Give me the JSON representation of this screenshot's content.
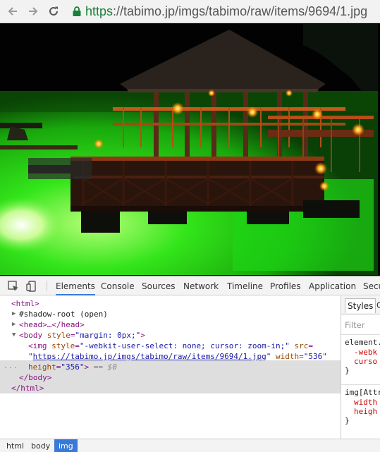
{
  "browser": {
    "url_scheme": "https",
    "url_rest": "://tabimo.jp/imgs/tabimo/raw/items/9694/1.jpg",
    "icons": {
      "back": "arrow-left-icon",
      "forward": "arrow-right-icon",
      "reload": "reload-icon",
      "lock": "lock-icon"
    }
  },
  "page": {
    "image_alt": "Night photo of a lit wooden pier pavilion over green-glowing water"
  },
  "devtools": {
    "tabs": [
      "Elements",
      "Console",
      "Sources",
      "Network",
      "Timeline",
      "Profiles",
      "Application",
      "Secu"
    ],
    "active_tab": "Elements",
    "icons": {
      "inspect": "inspect-element-icon",
      "device": "device-mode-icon"
    },
    "dom": {
      "html_open": "<html>",
      "shadow_root": "#shadow-root (open)",
      "head": "<head>…</head>",
      "body_open_tag": "<body",
      "body_attr_name": "style",
      "body_attr_val": "\"margin: 0px;\"",
      "body_close_bracket": ">",
      "img_open": "<img",
      "img_style_name": "style",
      "img_style_val": "\"-webkit-user-select: none; cursor: zoom-in;\"",
      "img_src_name": "src",
      "img_src_val": "https://tabimo.jp/imgs/tabimo/raw/items/9694/1.jpg",
      "img_width_name": "width",
      "img_width_val": "\"536\"",
      "img_height_name": "height",
      "img_height_val": "\"356\"",
      "img_close": ">",
      "selected_marker": "== $0",
      "body_close": "</body>",
      "html_close": "</html>",
      "dots": "..."
    },
    "styles": {
      "tab": "Styles",
      "tab2": "C",
      "filter_placeholder": "Filter",
      "rule1_selector": "element.",
      "rule1_prop1": "-webk",
      "rule1_prop2": "curso",
      "rule1_close": "}",
      "rule2_selector": "img[Attr",
      "rule2_prop1": "width",
      "rule2_prop2": "heigh",
      "rule2_close": "}"
    },
    "breadcrumbs": [
      "html",
      "body",
      "img"
    ],
    "active_breadcrumb": "img"
  }
}
